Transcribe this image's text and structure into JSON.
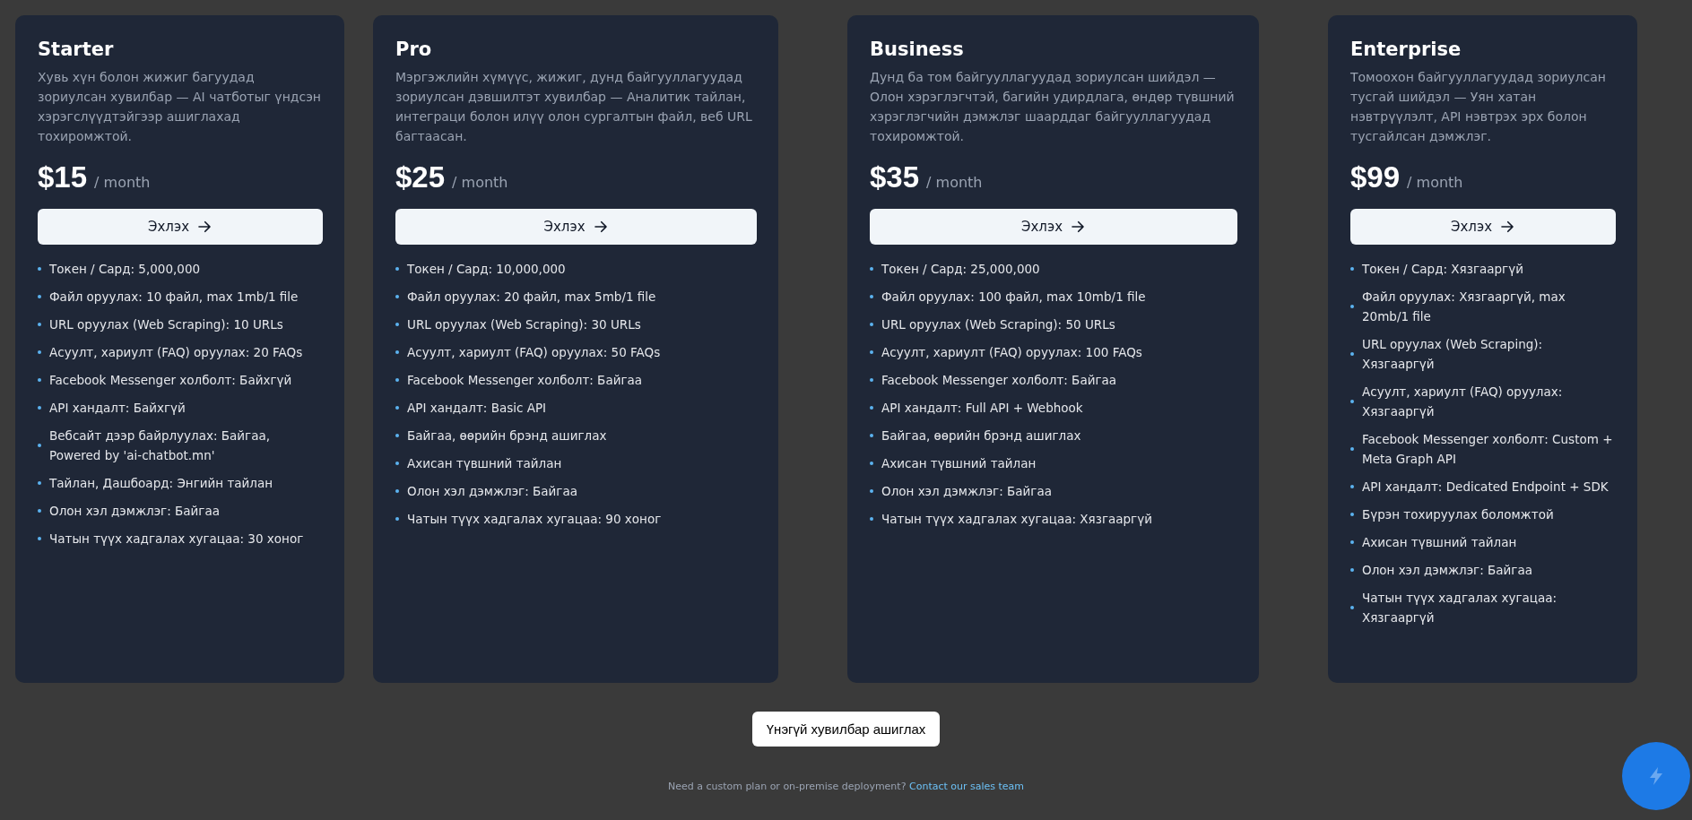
{
  "plans": [
    {
      "name": "Starter",
      "description": "Хувь хүн болон жижиг багуудад зориулсан хувилбар — AI чатботыг үндсэн хэрэгслүүдтэйгээр ашиглахад тохиромжтой.",
      "price": "$15",
      "period": "/ month",
      "button": "Эхлэх",
      "features": [
        "Токен / Сард: 5,000,000",
        "Файл оруулах: 10 файл, max 1mb/1 file",
        "URL оруулах (Web Scraping): 10 URLs",
        "Асуулт, хариулт (FAQ) оруулах: 20 FAQs",
        "Facebook Messenger холболт: Байхгүй",
        "API хандалт: Байхгүй",
        "Вебсайт дээр байрлуулах: Байгаа, Powered by 'ai-chatbot.mn'",
        "Тайлан, Дашбоард: Энгийн тайлан",
        "Олон хэл дэмжлэг: Байгаа",
        "Чатын түүх хадгалах хугацаа: 30 хоног"
      ]
    },
    {
      "name": "Pro",
      "description": "Мэргэжлийн хүмүүс, жижиг, дунд байгууллагуудад зориулсан дэвшилтэт хувилбар — Аналитик тайлан, интеграци болон илүү олон сургалтын файл, веб URL багтаасан.",
      "price": "$25",
      "period": "/ month",
      "button": "Эхлэх",
      "features": [
        "Токен / Сард: 10,000,000",
        "Файл оруулах: 20 файл, max 5mb/1 file",
        "URL оруулах (Web Scraping): 30 URLs",
        "Асуулт, хариулт (FAQ) оруулах: 50 FAQs",
        "Facebook Messenger холболт: Байгаа",
        "API хандалт: Basic API",
        "Байгаа, өөрийн брэнд ашиглах",
        "Ахисан түвшний тайлан",
        "Олон хэл дэмжлэг: Байгаа",
        "Чатын түүх хадгалах хугацаа: 90 хоног"
      ]
    },
    {
      "name": "Business",
      "description": "Дунд ба том байгууллагуудад зориулсан шийдэл — Олон хэрэглэгчтэй, багийн удирдлага, өндөр түвшний хэрэглэгчийн дэмжлэг шаарддаг байгууллагуудад тохиромжтой.",
      "price": "$35",
      "period": "/ month",
      "button": "Эхлэх",
      "features": [
        "Токен / Сард: 25,000,000",
        "Файл оруулах: 100 файл, max 10mb/1 file",
        "URL оруулах (Web Scraping): 50 URLs",
        "Асуулт, хариулт (FAQ) оруулах: 100 FAQs",
        "Facebook Messenger холболт: Байгаа",
        "API хандалт: Full API + Webhook",
        "Байгаа, өөрийн брэнд ашиглах",
        "Ахисан түвшний тайлан",
        "Олон хэл дэмжлэг: Байгаа",
        "Чатын түүх хадгалах хугацаа: Хязгааргүй"
      ]
    },
    {
      "name": "Enterprise",
      "description": "Томоохон байгууллагуудад зориулсан тусгай шийдэл — Уян хатан нэвтрүүлэлт, API нэвтрэх эрх болон тусгайлсан дэмжлэг.",
      "price": "$99",
      "period": "/ month",
      "button": "Эхлэх",
      "features": [
        "Токен / Сард: Хязгааргүй",
        "Файл оруулах: Хязгааргүй, max 20mb/1 file",
        "URL оруулах (Web Scraping): Хязгааргүй",
        "Асуулт, хариулт (FAQ) оруулах: Хязгааргүй",
        "Facebook Messenger холболт: Custom + Meta Graph API",
        "API хандалт: Dedicated Endpoint + SDK",
        "Бүрэн тохируулах боломжтой",
        "Ахисан түвшний тайлан",
        "Олон хэл дэмжлэг: Байгаа",
        "Чатын түүх хадгалах хугацаа: Хязгааргүй"
      ]
    }
  ],
  "free_button": "Үнэгүй хувилбар ашиглах",
  "footer": {
    "note": "Need a custom plan or on-premise deployment?",
    "link": "Contact our sales team"
  }
}
